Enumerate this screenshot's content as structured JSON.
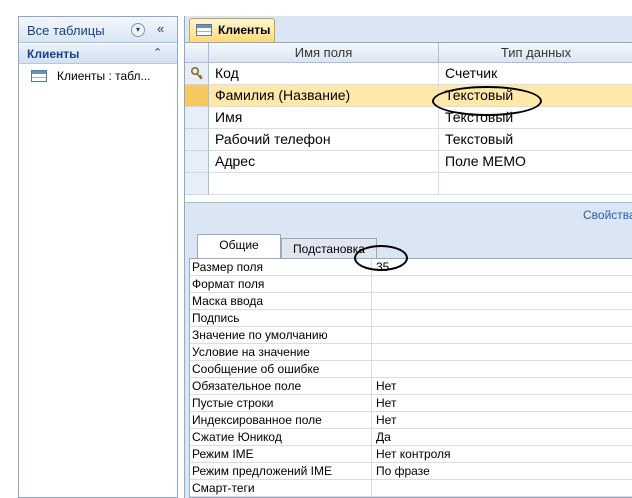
{
  "nav": {
    "title": "Все таблицы",
    "collapse_glyph": "«",
    "dropdown_glyph": "▾",
    "group": {
      "title": "Клиенты",
      "toggle_glyph": "⌃"
    },
    "items": [
      {
        "label": "Клиенты : табл...",
        "icon": "table-icon"
      }
    ]
  },
  "object_tab": {
    "label": "Клиенты",
    "icon": "table-icon"
  },
  "design_grid": {
    "columns": [
      "Имя поля",
      "Тип данных"
    ],
    "rows": [
      {
        "field": "Код",
        "type": "Счетчик",
        "primary_key": true
      },
      {
        "field": "Фамилия (Название)",
        "type": "Текстовый",
        "selected": true
      },
      {
        "field": "Имя",
        "type": "Текстовый"
      },
      {
        "field": "Рабочий телефон",
        "type": "Текстовый"
      },
      {
        "field": "Адрес",
        "type": "Поле MEMO"
      }
    ]
  },
  "properties_label": "Свойства",
  "property_tabs": [
    "Общие",
    "Подстановка"
  ],
  "properties": [
    {
      "name": "Размер поля",
      "value": "35"
    },
    {
      "name": "Формат поля",
      "value": ""
    },
    {
      "name": "Маска ввода",
      "value": ""
    },
    {
      "name": "Подпись",
      "value": ""
    },
    {
      "name": "Значение по умолчанию",
      "value": ""
    },
    {
      "name": "Условие на значение",
      "value": ""
    },
    {
      "name": "Сообщение об ошибке",
      "value": ""
    },
    {
      "name": "Обязательное поле",
      "value": "Нет"
    },
    {
      "name": "Пустые строки",
      "value": "Нет"
    },
    {
      "name": "Индексированное поле",
      "value": "Нет"
    },
    {
      "name": "Сжатие Юникод",
      "value": "Да"
    },
    {
      "name": "Режим IME",
      "value": "Нет контроля"
    },
    {
      "name": "Режим предложений IME",
      "value": "По фразе"
    },
    {
      "name": "Смарт-теги",
      "value": ""
    }
  ],
  "colors": {
    "accent": "#15428b",
    "selected_row": "#ffe8a8",
    "tab_gradient": "#ffd978",
    "pane_background": "#dbe6f4"
  }
}
